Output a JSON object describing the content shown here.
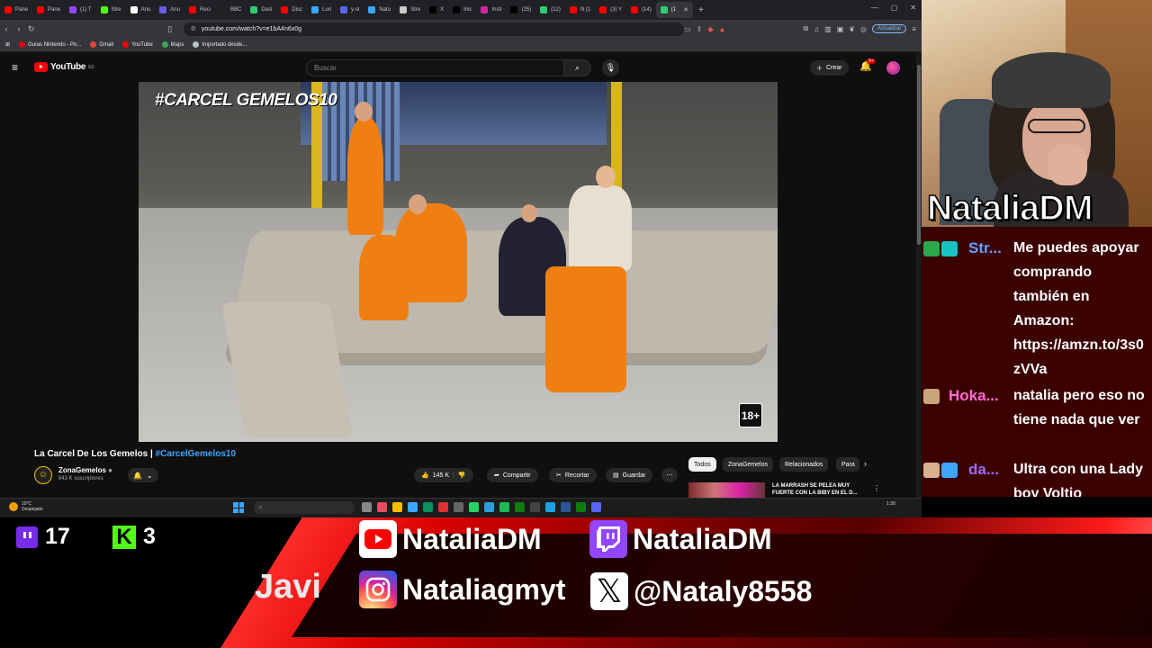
{
  "browser": {
    "tabs": [
      {
        "label": "Pane",
        "color": "#ff0000"
      },
      {
        "label": "Pane",
        "color": "#ff0000"
      },
      {
        "label": "(1) T",
        "color": "#9146ff"
      },
      {
        "label": "Stre",
        "color": "#53fc18"
      },
      {
        "label": "Anu",
        "color": "#ffffff"
      },
      {
        "label": "Anu",
        "color": "#6c5ce7"
      },
      {
        "label": "Reci",
        "color": "#ff0000"
      },
      {
        "label": "BBC",
        "color": "#222222"
      },
      {
        "label": "Dasl",
        "color": "#2ecc71"
      },
      {
        "label": "Disc",
        "color": "#ff0000"
      },
      {
        "label": "Luri",
        "color": "#3ea6ff"
      },
      {
        "label": "y-sl",
        "color": "#5865f2"
      },
      {
        "label": "Natu",
        "color": "#3ea6ff"
      },
      {
        "label": "Stre",
        "color": "#cccccc"
      },
      {
        "label": "X",
        "color": "#000000"
      },
      {
        "label": "Inic",
        "color": "#000000"
      },
      {
        "label": "Insti",
        "color": "#d6249f"
      },
      {
        "label": "(25)",
        "color": "#000000"
      },
      {
        "label": "(12)",
        "color": "#2ecc71"
      },
      {
        "label": "N (1",
        "color": "#ff0000"
      },
      {
        "label": "(3) Y",
        "color": "#ff0000"
      },
      {
        "label": "(14)",
        "color": "#ff0000"
      },
      {
        "label": "(1",
        "color": "#2ecc71"
      }
    ],
    "url": "youtube.com/watch?v=e1bA4n6x0g",
    "update_label": "Actualizar",
    "bookmarks": [
      {
        "label": "Guías Nintendo - Po...",
        "color": "#e60012"
      },
      {
        "label": "Gmail",
        "color": "#ea4335"
      },
      {
        "label": "YouTube",
        "color": "#ff0000"
      },
      {
        "label": "Maps",
        "color": "#34a853"
      },
      {
        "label": "Importado desde...",
        "color": "#bdc1c6"
      }
    ]
  },
  "youtube": {
    "logo_text": "YouTube",
    "country": "ES",
    "search_placeholder": "Buscar",
    "create_label": "Crear",
    "notifications": "9+",
    "video_overlay_logo": "#CARCEL GEMELOS10",
    "age_badge": "18+",
    "title_main": "La Carcel De Los Gemelos | ",
    "title_hashtag": "#CarcelGemelos10",
    "channel_name": "ZonaGemelos",
    "channel_subs": "843 K suscriptores",
    "likes": "145 K",
    "share_label": "Compartir",
    "clip_label": "Recortar",
    "save_label": "Guardar",
    "chips": [
      "Todos",
      "ZonaGemelos",
      "Relacionados",
      "Para"
    ],
    "recommended_title": "LA MARRASH SE PELEA MUY FUERTE CON LA BIBY EN EL D..."
  },
  "taskbar": {
    "weather_temp": "10°C",
    "weather_desc": "Despejado",
    "clock": "1:30"
  },
  "stream": {
    "streamer_name": "NataliaDM",
    "twitch_viewers": "17",
    "kick_viewers": "3",
    "ticker_text": "Javi",
    "socials": {
      "youtube": "NataliaDM",
      "twitch": "NataliaDM",
      "instagram": "Nataliagmyt",
      "x": "@Nataly8558"
    }
  },
  "chat": [
    {
      "user": "Str...",
      "user_color": "#6aa0ff",
      "text": "Me puedes apoyar comprando también en Amazon: https://amzn.to/3s0zVVa",
      "badges": [
        "#2aa84a",
        "#19c3c3"
      ]
    },
    {
      "user": "Hoka...",
      "user_color": "#ff6ad5",
      "text": "natalia pero eso no tiene nada que ver",
      "badges": [
        "#c9a37a"
      ]
    },
    {
      "user": "da...",
      "user_color": "#9b6bff",
      "text": "Ultra con una Lady boy Voltio",
      "badges": [
        "#d8b090",
        "#3ea6ff"
      ]
    }
  ]
}
